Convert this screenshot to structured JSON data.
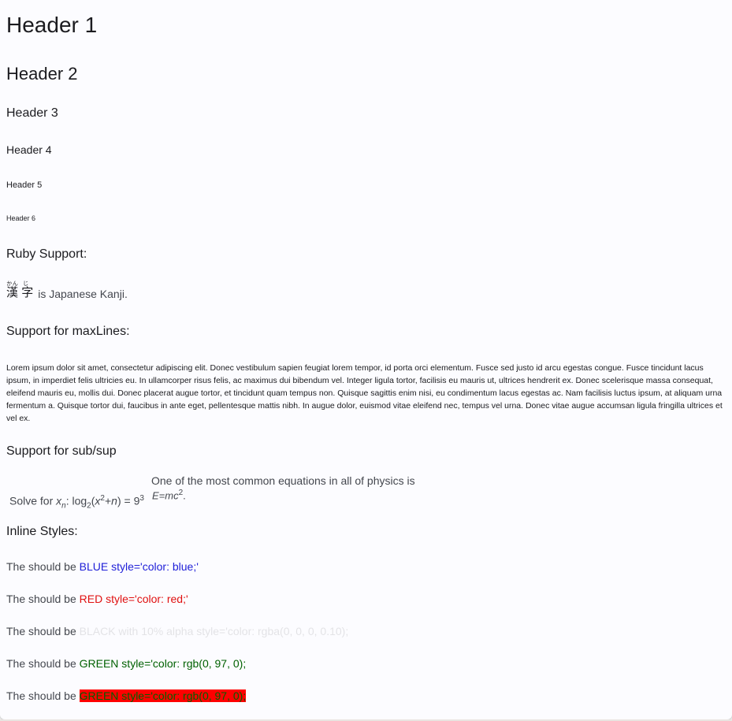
{
  "headers": {
    "h1": "Header 1",
    "h2": "Header 2",
    "h3": "Header 3",
    "h4": "Header 4",
    "h5": "Header 5",
    "h6": "Header 6"
  },
  "ruby": {
    "title": "Ruby Support:",
    "base1": "漢",
    "rt1": "かん",
    "base2": "字",
    "rt2": "じ",
    "suffix": "is Japanese Kanji."
  },
  "max_lines": {
    "title": "Support for maxLines:",
    "text": "Lorem ipsum dolor sit amet, consectetur adipiscing elit. Donec vestibulum sapien feugiat lorem tempor, id porta orci elementum. Fusce sed justo id arcu egestas congue. Fusce tincidunt lacus ipsum, in imperdiet felis ultricies eu. In ullamcorper risus felis, ac maximus dui bibendum vel. Integer ligula tortor, facilisis eu mauris ut, ultrices hendrerit ex. Donec scelerisque massa consequat, eleifend mauris eu, mollis dui. Donec placerat augue tortor, et tincidunt quam tempus non. Quisque sagittis enim nisi, eu condimentum lacus egestas ac. Nam facilisis luctus ipsum, at aliquam urna fermentum a. Quisque tortor dui, faucibus in ante eget, pellentesque mattis nibh. In augue dolor, euismod vitae eleifend nec, tempus vel urna. Donec vitae augue accumsan ligula fringilla ultrices et vel ex."
  },
  "subsup": {
    "title": "Support for sub/sup",
    "solve_prefix": "Solve for ",
    "x": "x",
    "n_sub": "n",
    "colon_log": ": log",
    "log_sub": "2",
    "open_paren": "(",
    "x2": "x",
    "sq": "2",
    "plus_n": "+",
    "n": "n",
    "close_eq": ") = 9",
    "nine_sup": "3",
    "physics_text": "One of the most common equations in all of physics is",
    "e_eq_mc": "E=mc",
    "mc_sup": "2",
    "period": "."
  },
  "inline_styles": {
    "title": "Inline Styles:",
    "prefix": "The should be ",
    "blue": "BLUE style='color: blue;'",
    "red": "RED style='color: red;'",
    "black": "BLACK with 10% alpha style='color: rgba(0, 0, 0, 0.10);",
    "green": "GREEN style='color: rgb(0, 97, 0);",
    "green_bg": "GREEN style='color: rgb(0, 97, 0);"
  },
  "colors": {
    "background": "#fcfcff",
    "blue": "#2020d8",
    "red": "#e01010",
    "green": "#006100",
    "highlight": "#ff0000"
  }
}
